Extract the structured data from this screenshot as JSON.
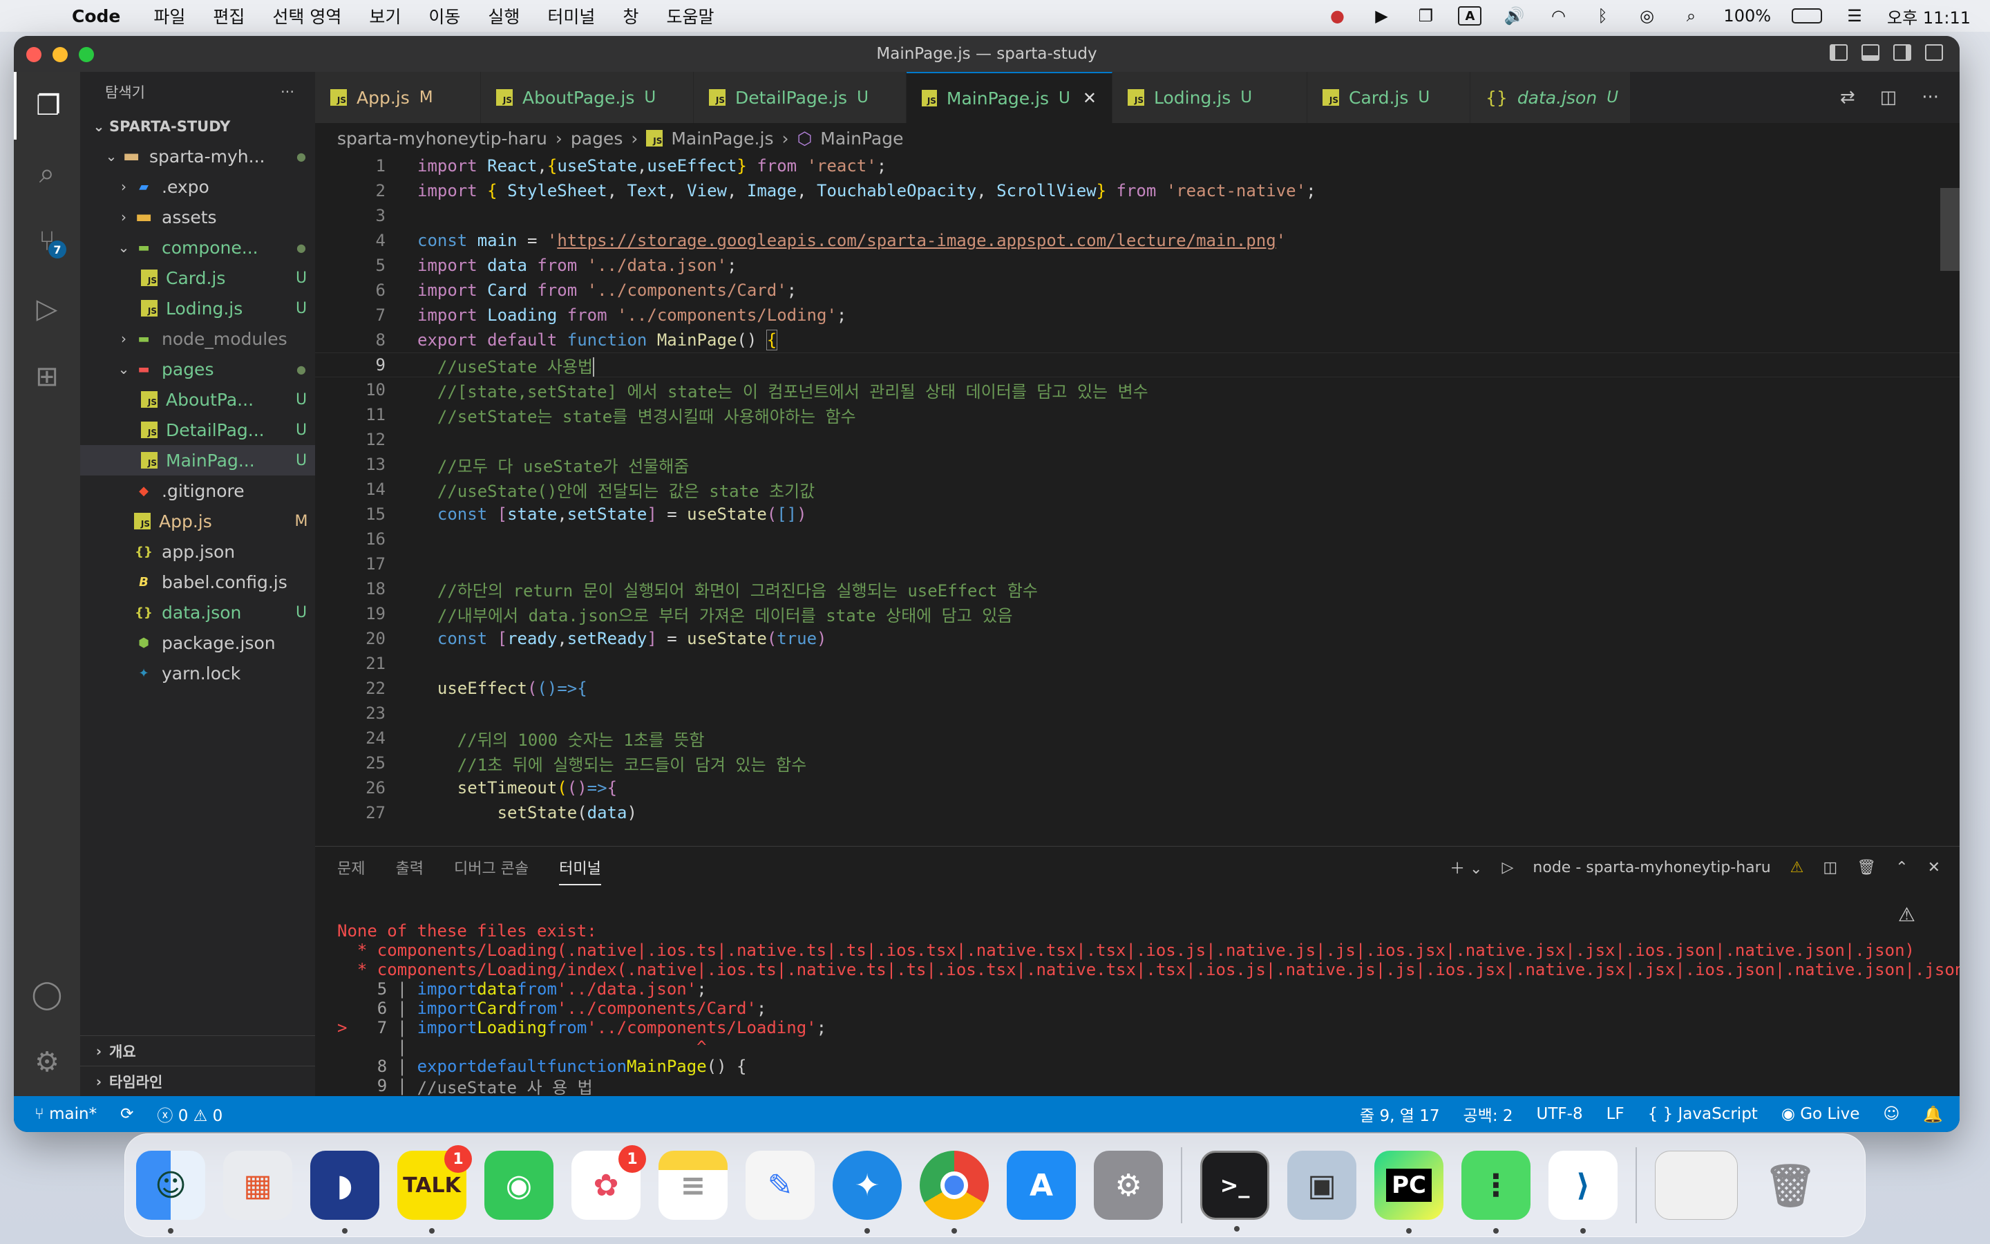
{
  "menubar": {
    "app": "Code",
    "items": [
      "파일",
      "편집",
      "선택 영역",
      "보기",
      "이동",
      "실행",
      "터미널",
      "창",
      "도움말"
    ],
    "battery": "100%",
    "clock": "오후 11:11"
  },
  "window": {
    "title": "MainPage.js — sparta-study"
  },
  "activity": {
    "scm_badge": "7"
  },
  "explorer": {
    "header": "탐색기",
    "more": "···",
    "root": "SPARTA-STUDY",
    "items": [
      {
        "name": "sparta-myh...",
        "status": "●"
      },
      {
        "name": ".expo",
        "status": ""
      },
      {
        "name": "assets",
        "status": ""
      },
      {
        "name": "compone...",
        "status": "●"
      },
      {
        "name": "Card.js",
        "status": "U"
      },
      {
        "name": "Loding.js",
        "status": "U"
      },
      {
        "name": "node_modules",
        "status": ""
      },
      {
        "name": "pages",
        "status": "●"
      },
      {
        "name": "AboutPa...",
        "status": "U"
      },
      {
        "name": "DetailPag...",
        "status": "U"
      },
      {
        "name": "MainPag...",
        "status": "U"
      },
      {
        "name": ".gitignore",
        "status": ""
      },
      {
        "name": "App.js",
        "status": "M"
      },
      {
        "name": "app.json",
        "status": ""
      },
      {
        "name": "babel.config.js",
        "status": ""
      },
      {
        "name": "data.json",
        "status": "U"
      },
      {
        "name": "package.json",
        "status": ""
      },
      {
        "name": "yarn.lock",
        "status": ""
      }
    ],
    "outline": "개요",
    "timeline": "타임라인"
  },
  "tabs": [
    {
      "label": "App.js",
      "status": "M"
    },
    {
      "label": "AboutPage.js",
      "status": "U"
    },
    {
      "label": "DetailPage.js",
      "status": "U"
    },
    {
      "label": "MainPage.js",
      "status": "U"
    },
    {
      "label": "Loding.js",
      "status": "U"
    },
    {
      "label": "Card.js",
      "status": "U"
    },
    {
      "label": "data.json",
      "status": "U"
    }
  ],
  "breadcrumb": [
    "sparta-myhoneytip-haru",
    "pages",
    "MainPage.js",
    "MainPage"
  ],
  "editor": {
    "line_numbers": [
      "1",
      "2",
      "3",
      "4",
      "5",
      "6",
      "7",
      "8",
      "9",
      "10",
      "11",
      "12",
      "13",
      "14",
      "15",
      "16",
      "17",
      "18",
      "19",
      "20",
      "21",
      "22",
      "23",
      "24",
      "25",
      "26",
      "27"
    ]
  },
  "panel": {
    "tabs": [
      "문제",
      "출력",
      "디버그 콘솔",
      "터미널"
    ],
    "terminal_name": "node - sparta-myhoneytip-haru",
    "terminal": [
      "None of these files exist:",
      "  * components/Loading(.native|.ios.ts|.native.ts|.ts|.ios.tsx|.native.tsx|.tsx|.ios.js|.native.js|.js|.ios.jsx|.native.jsx|.jsx|.ios.json|.native.json|.json)",
      "  * components/Loading/index(.native|.ios.ts|.native.ts|.ts|.ios.tsx|.native.tsx|.tsx|.ios.js|.native.js|.js|.ios.jsx|.native.jsx|.jsx|.ios.json|.native.json|.json)"
    ]
  },
  "statusbar": {
    "branch": "main*",
    "errors": "0",
    "warnings": "0",
    "position": "줄 9, 열 17",
    "spaces": "공백: 2",
    "encoding": "UTF-8",
    "eol": "LF",
    "language": "JavaScript",
    "golive": "Go Live"
  },
  "dock": {
    "talk_label": "TALK",
    "talk_badge": "1",
    "photos_badge": "1",
    "pycharm_label": "PC"
  }
}
